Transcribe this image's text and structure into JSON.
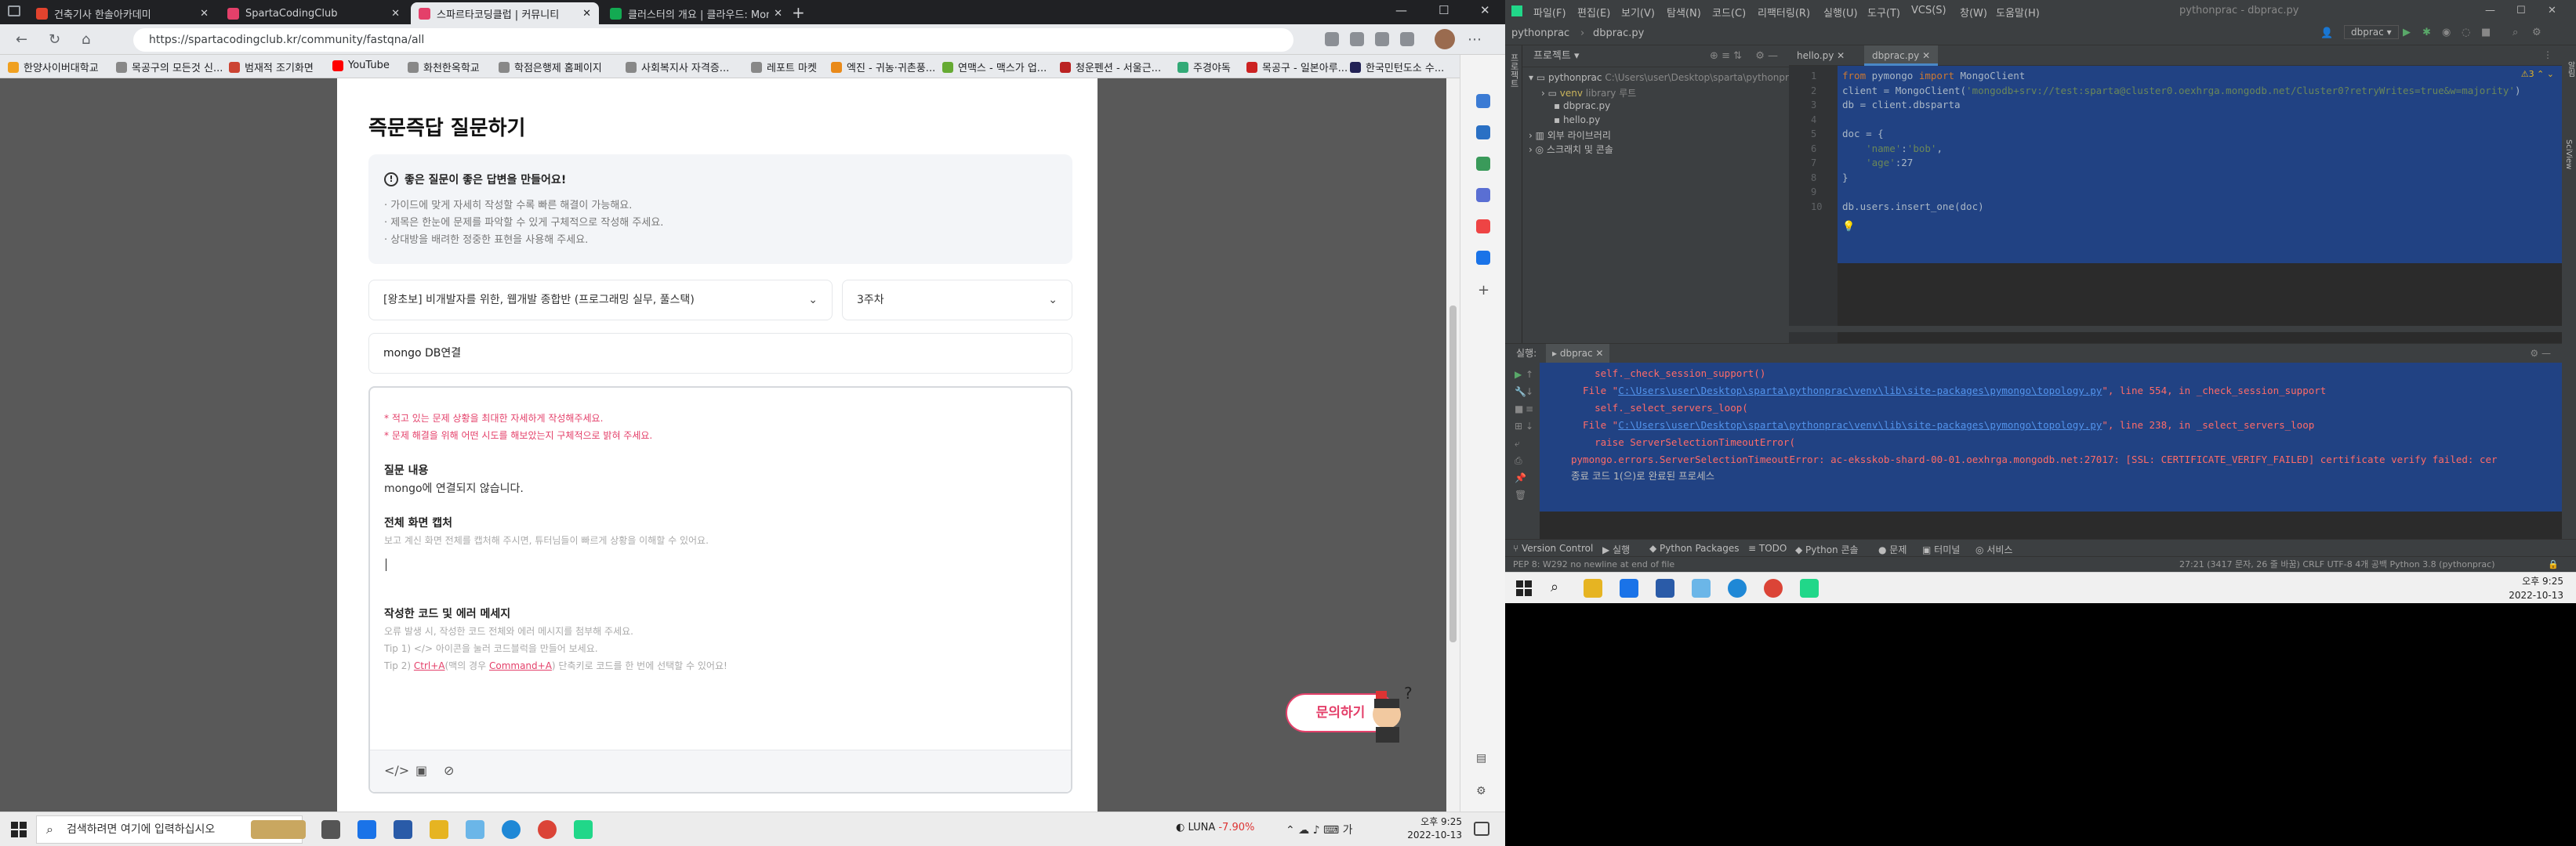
{
  "browser": {
    "tabs": [
      {
        "label": "건축기사 한솔아카데미",
        "color": "#e2432e"
      },
      {
        "label": "SpartaCodingClub",
        "color": "#e4406a"
      },
      {
        "label": "스파르타코딩클럽 | 커뮤니티",
        "color": "#e4406a"
      },
      {
        "label": "클러스터의 개요 | 클라우드: Mon",
        "color": "#13aa52"
      }
    ],
    "url": "https://spartacodingclub.kr/community/fastqna/all",
    "bookmarks": [
      "한양사이버대학교",
      "목공구의 모든것 신...",
      "범재적 조기화면",
      "YouTube",
      "화천한옥학교",
      "학점은행제 홈페이지",
      "사회복지사 자격증...",
      "레포트 마켓",
      "엑진 - 귀농·귀촌풍...",
      "연맥스 - 맥스가 업...",
      "청운펜션 - 서울근...",
      "주경야독",
      "목공구 - 일본아루...",
      "한국민턴도소 수..."
    ]
  },
  "page": {
    "title": "즉문즉답 질문하기",
    "tips": {
      "heading": "좋은 질문이 좋은 답변을 만들어요!",
      "items": [
        "· 가이드에 맞게 자세히 작성할 수록 빠른 해결이 가능해요.",
        "· 제목은 한눈에 문제를 파악할 수 있게 구체적으로 작성해 주세요.",
        "· 상대방을 배려한 정중한 표현을 사용해 주세요."
      ]
    },
    "course_select": "[왕초보] 비개발자를 위한, 웹개발 종합반 (프로그래밍 실무, 풀스택)",
    "week_select": "3주차",
    "question_title": "mongo DB연결",
    "editor": {
      "warn1": "* 적고 있는 문제 상황을 최대한 자세하게 작성해주세요.",
      "warn2": "* 문제 해결을 위해 어떤 시도를 해보았는지 구체적으로 밝혀 주세요.",
      "q_heading": "질문 내용",
      "q_body": "mongo에 연결되지 않습니다.",
      "shot_heading": "전체 화면 캡처",
      "shot_hint": "보고 계신 화면 전체를 캡처해 주시면, 튜터님들이 빠르게 상황을 이해할 수 있어요.",
      "code_heading": "작성한 코드 및 에러 메세지",
      "code_hint1": "오류 발생 시, 작성한 코드 전체와 에러 메시지를 첨부해 주세요.",
      "code_hint2": "Tip 1) </> 아이콘을 눌러 코드블럭을 만들어 보세요.",
      "code_hint3_a": "Tip 2) ",
      "code_hint3_b": "Ctrl+A",
      "code_hint3_c": "(맥의 경우 ",
      "code_hint3_d": "Command+A",
      "code_hint3_e": ") 단축키로 코드를 한 번에 선택할 수 있어요!"
    },
    "inquiry_button": "문의하기"
  },
  "taskbar": {
    "search_placeholder": "검색하려면 여기에 입력하십시오",
    "luna_label": "LUNA",
    "luna_change": "-7.90%",
    "time": "오후 9:25",
    "date": "2022-10-13"
  },
  "pycharm": {
    "menu": [
      "파일(F)",
      "편집(E)",
      "보기(V)",
      "탐색(N)",
      "코드(C)",
      "리팩터링(R)",
      "실행(U)",
      "도구(T)",
      "VCS(S)",
      "창(W)",
      "도움말(H)"
    ],
    "window_title": "pythonprac - dbprac.py",
    "breadcrumb_project": "pythonprac",
    "breadcrumb_file": "dbprac.py",
    "run_config": "dbprac",
    "project_label": "프로젝트",
    "tree": {
      "root": "pythonprac",
      "root_path": "C:\\Users\\user\\Desktop\\sparta\\pythonprac",
      "venv": "venv",
      "venv_hint": "library 루트",
      "file1": "dbprac.py",
      "file2": "hello.py",
      "ext_libs": "외부 라이브러리",
      "scratches": "스크래치 및 콘솔"
    },
    "editor_tabs": [
      "hello.py",
      "dbprac.py"
    ],
    "code_lines": [
      {
        "n": "1",
        "t": "from pymongo import MongoClient"
      },
      {
        "n": "2",
        "t": "client = MongoClient('mongodb+srv://test:sparta@cluster0.oexhrga.mongodb.net/Cluster0?retryWrites=true&w=majority')"
      },
      {
        "n": "3",
        "t": "db = client.dbsparta"
      },
      {
        "n": "4",
        "t": ""
      },
      {
        "n": "5",
        "t": "doc = {"
      },
      {
        "n": "6",
        "t": "    'name':'bob',"
      },
      {
        "n": "7",
        "t": "    'age':27"
      },
      {
        "n": "8",
        "t": "}"
      },
      {
        "n": "9",
        "t": ""
      },
      {
        "n": "10",
        "t": "db.users.insert_one(doc)"
      }
    ],
    "inspection_count": "3",
    "run_label": "실행:",
    "run_tab": "dbprac",
    "output": [
      {
        "t": "    self._check_session_support()"
      },
      {
        "a": "  File \"",
        "link": "C:\\Users\\user\\Desktop\\sparta\\pythonprac\\venv\\lib\\site-packages\\pymongo\\topology.py",
        "b": "\", line 554, in _check_session_support"
      },
      {
        "t": "    self._select_servers_loop("
      },
      {
        "a": "  File \"",
        "link": "C:\\Users\\user\\Desktop\\sparta\\pythonprac\\venv\\lib\\site-packages\\pymongo\\topology.py",
        "b": "\", line 238, in _select_servers_loop"
      },
      {
        "t": "    raise ServerSelectionTimeoutError("
      },
      {
        "t": "pymongo.errors.ServerSelectionTimeoutError: ac-eksskob-shard-00-01.oexhrga.mongodb.net:27017: [SSL: CERTIFICATE_VERIFY_FAILED] certificate verify failed: cer"
      }
    ],
    "exit_msg": "종료 코드 1(으)로 완료된 프로세스",
    "bottom_tabs": [
      "Version Control",
      "실행",
      "Python Packages",
      "TODO",
      "Python 콘솔",
      "문제",
      "터미널",
      "서비스"
    ],
    "status_left": "PEP 8: W292 no newline at end of file",
    "status_right": "27:21 (3417 문자, 26 줄 바꿈)   CRLF   UTF-8   4개 공백   Python 3.8 (pythonprac)",
    "tb_time": "오후 9:25",
    "tb_date": "2022-10-13"
  }
}
